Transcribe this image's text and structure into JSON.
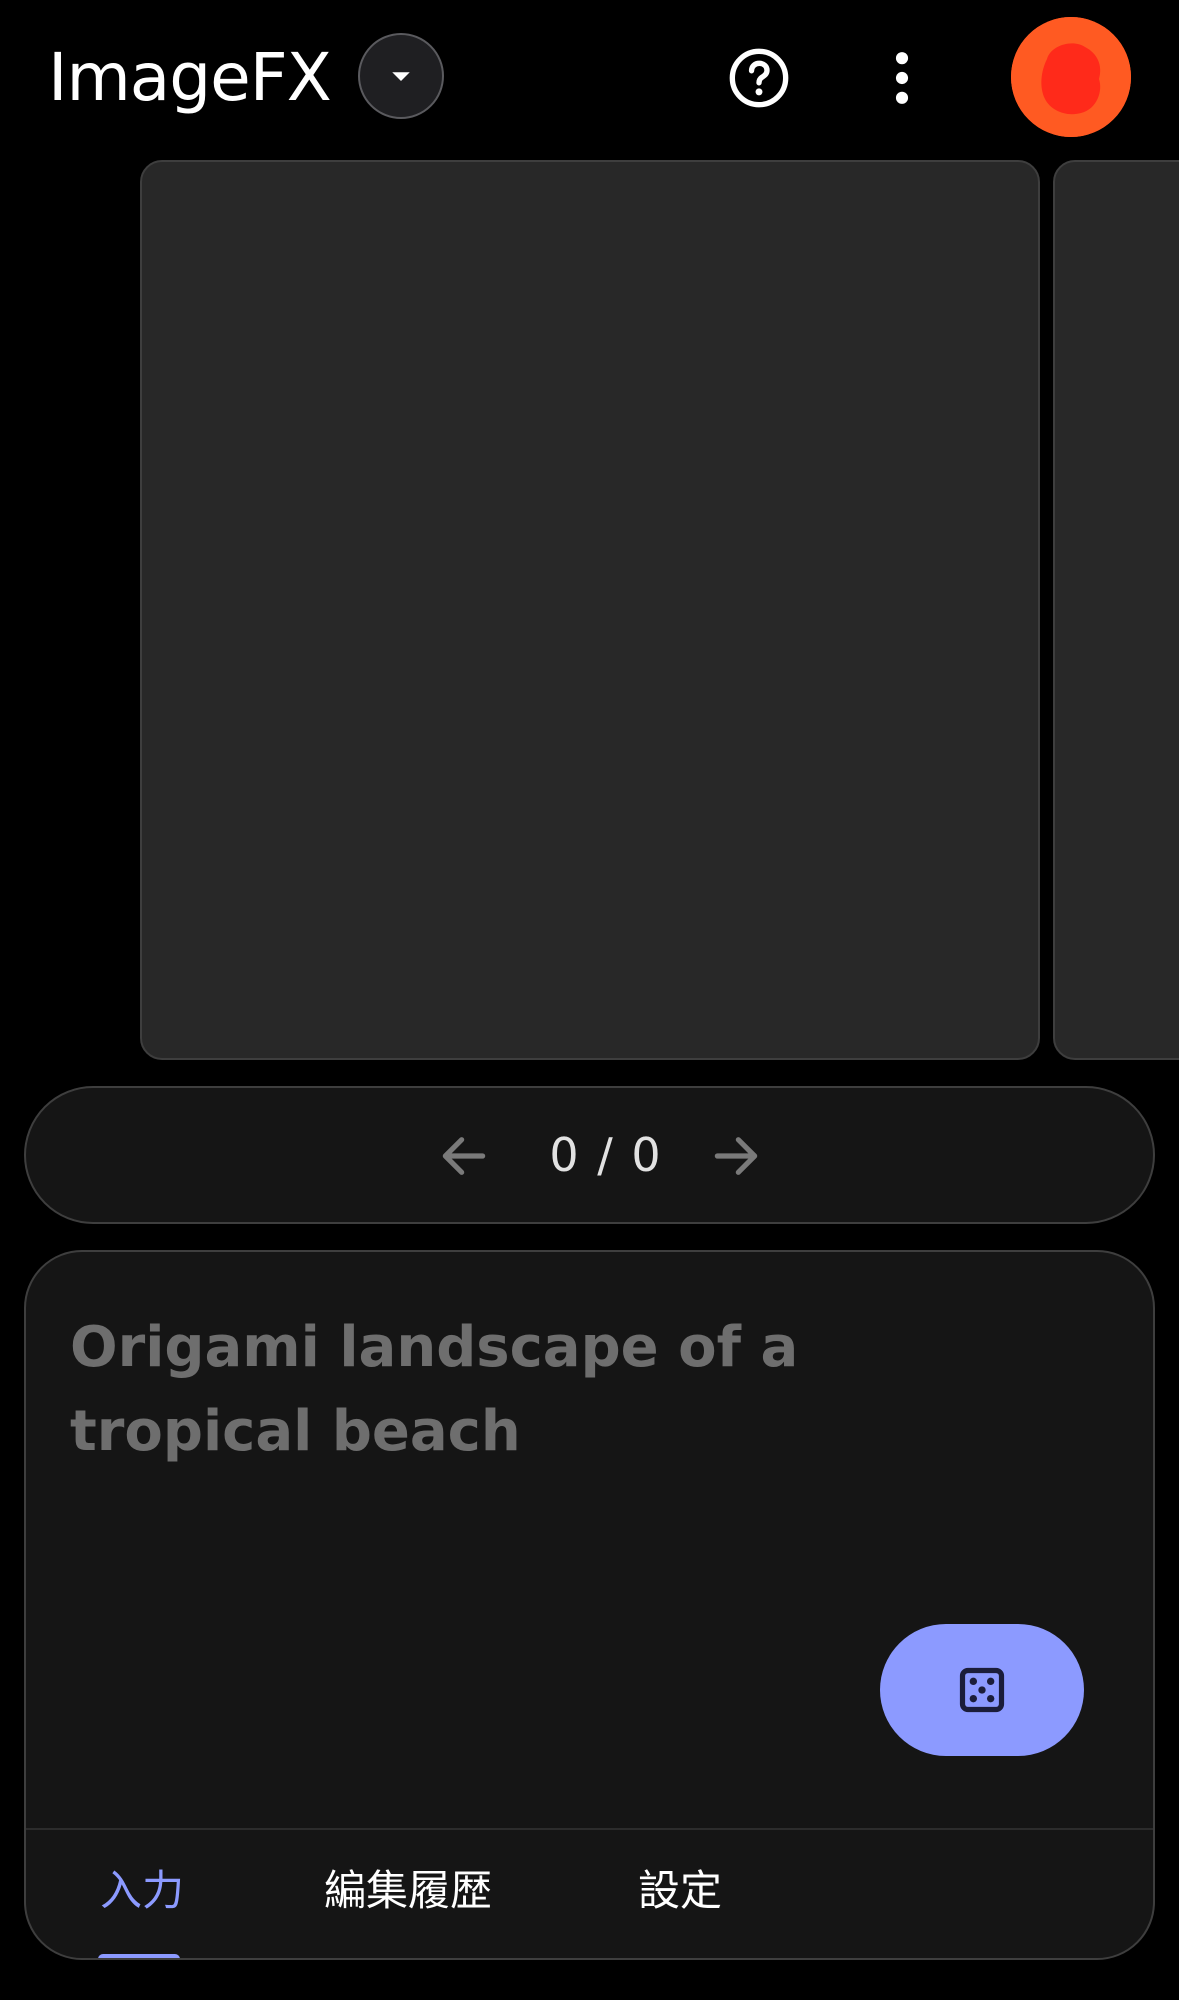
{
  "header": {
    "app_title": "ImageFX",
    "dropdown_icon": "caret-down-icon",
    "help_icon": "help-circle-icon",
    "more_icon": "more-vert-icon",
    "avatar_color": "#ff5a22"
  },
  "carousel": {
    "card_color": "#282828"
  },
  "pager": {
    "count": "0 / 0",
    "prev_icon": "arrow-left-icon",
    "next_icon": "arrow-right-icon"
  },
  "prompt": {
    "placeholder": "Origami landscape of a tropical beach",
    "random_icon": "dice-icon",
    "accent_color": "#8c9aff"
  },
  "tabs": [
    {
      "label": "入力",
      "active": true
    },
    {
      "label": "編集履歴",
      "active": false
    },
    {
      "label": "設定",
      "active": false
    }
  ]
}
